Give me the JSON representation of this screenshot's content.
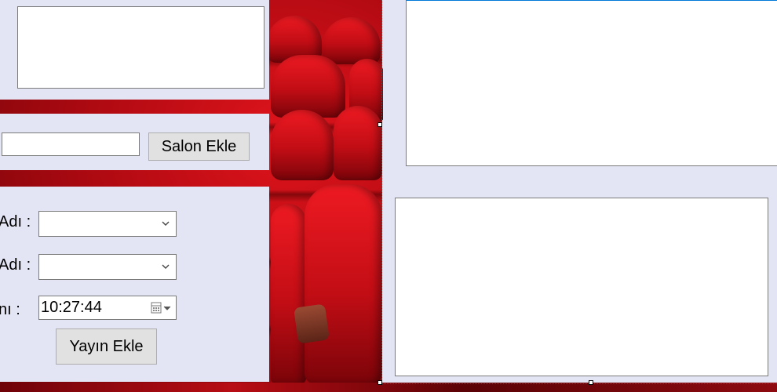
{
  "salon_section": {
    "add_button_label": "Salon Ekle",
    "name_value": ""
  },
  "yayin_section": {
    "row1_label": "Adı :",
    "row2_label": "Adı :",
    "row3_label": "nı :",
    "time_value": "10:27:44",
    "add_button_label": "Yayın Ekle"
  },
  "colors": {
    "form_background": "#e4e5f4",
    "button_face": "#e1e1e1",
    "seat_red": "#c20d15"
  },
  "icons": {
    "combo_dropdown": "chevron-down-icon",
    "time_picker": "calendar-icon"
  }
}
